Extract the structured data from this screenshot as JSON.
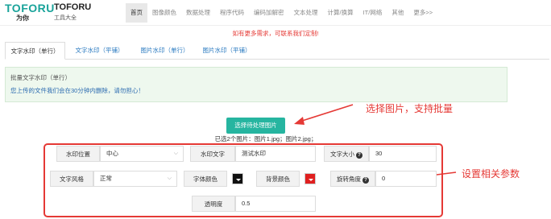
{
  "brand": {
    "logo_text": "TOFORU",
    "logo_sub": "为你",
    "site_name": "TOFORU",
    "tagline": "工具大全"
  },
  "nav": {
    "items": [
      "首页",
      "图像颜色",
      "数据处理",
      "程序代码",
      "编码加解密",
      "文本处理",
      "计算/换算",
      "IT/网络",
      "其他",
      "更多>>"
    ],
    "active_index": 0
  },
  "notice": "如有更多需求，可联系我们定制!",
  "tabs": {
    "items": [
      "文字水印（单行）",
      "文字水印（平铺）",
      "图片水印（单行）",
      "图片水印（平铺）"
    ],
    "active_index": 0
  },
  "info": {
    "title": "批量文字水印（单行）",
    "message": "您上传的文件我们会在30分钟内删除，请勿担心！"
  },
  "upload": {
    "button_label": "选择待处理图片",
    "selected_text": "已选2个图片：图片1.jpg；图片2.jpg；"
  },
  "annotations": {
    "select_images": "选择图片，支持批量",
    "set_params": "设置相关参数"
  },
  "form": {
    "position_label": "水印位置",
    "position_value": "中心",
    "text_label": "水印文字",
    "text_value": "测试水印",
    "font_size_label": "文字大小",
    "font_size_value": "30",
    "style_label": "文字风格",
    "style_value": "正常",
    "font_color_label": "字体颜色",
    "font_color": "#111111",
    "bg_color_label": "背景颜色",
    "bg_color": "#e02020",
    "rotation_label": "旋转角度",
    "rotation_value": "0",
    "opacity_label": "透明度",
    "opacity_value": "0.5"
  },
  "colors": {
    "accent": "#26b5a0",
    "annotation_red": "#e53935",
    "link_blue": "#2a7ac0"
  }
}
